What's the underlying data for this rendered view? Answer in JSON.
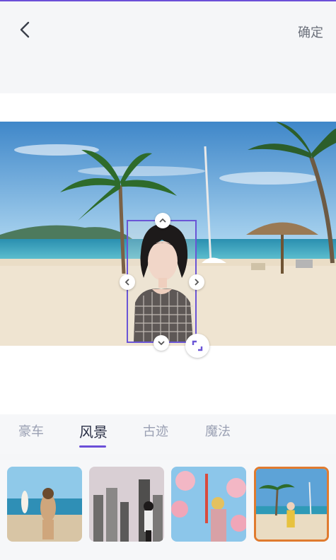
{
  "header": {
    "confirm_label": "确定",
    "back_icon": "back-arrow-icon"
  },
  "tabs": [
    {
      "label": "豪车",
      "active": false
    },
    {
      "label": "风景",
      "active": true
    },
    {
      "label": "古迹",
      "active": false
    },
    {
      "label": "魔法",
      "active": false
    }
  ],
  "thumbnails": [
    {
      "name": "beach-surf",
      "selected": false
    },
    {
      "name": "city-skyline",
      "selected": false
    },
    {
      "name": "tower-blossoms",
      "selected": false
    },
    {
      "name": "beach-palms",
      "selected": true
    }
  ],
  "colors": {
    "accent": "#6b4fd8",
    "selected_border": "#e07b2f"
  }
}
